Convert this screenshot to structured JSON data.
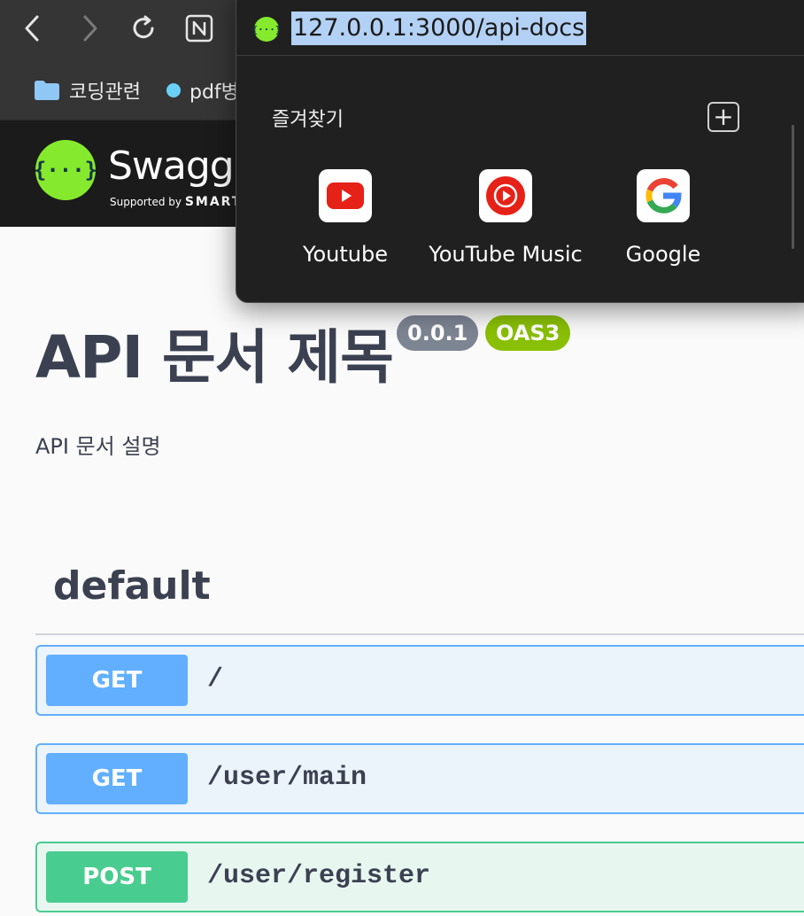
{
  "browser": {
    "url": "127.0.0.1:3000/api-docs",
    "bookmarks_bar": [
      {
        "label": "코딩관련",
        "icon": "folder-icon"
      },
      {
        "label": "pdf병",
        "icon": "dot-icon"
      }
    ],
    "popup": {
      "favorites_heading": "즐겨찾기",
      "add_label": "+",
      "favorites": [
        {
          "label": "Youtube",
          "icon": "youtube-icon"
        },
        {
          "label": "YouTube Music",
          "icon": "youtube-music-icon"
        },
        {
          "label": "Google",
          "icon": "google-icon"
        }
      ]
    }
  },
  "swagger": {
    "brand": "Swagge",
    "supported_by": "Supported by",
    "supported_brand": "SMART",
    "title": "API 문서 제목",
    "version_badge": "0.0.1",
    "oas_badge": "OAS3",
    "description": "API 문서 설명",
    "tag": "default",
    "operations": [
      {
        "method": "GET",
        "path": "/"
      },
      {
        "method": "GET",
        "path": "/user/main"
      },
      {
        "method": "POST",
        "path": "/user/register"
      }
    ]
  },
  "colors": {
    "get": "#61affe",
    "post": "#49cc90",
    "swagger_green": "#85ea2d",
    "oas_badge": "#89bf04",
    "version_badge": "#7d8492"
  }
}
